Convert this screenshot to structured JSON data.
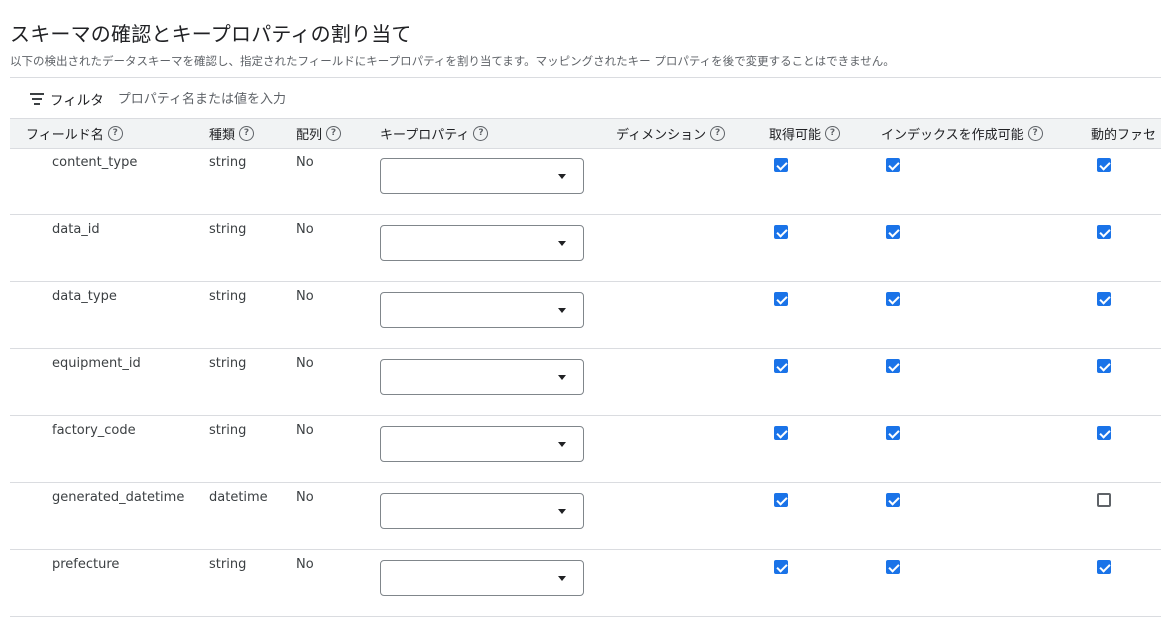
{
  "page": {
    "title": "スキーマの確認とキープロパティの割り当て",
    "description": "以下の検出されたデータスキーマを確認し、指定されたフィールドにキープロパティを割り当てます。マッピングされたキー プロパティを後で変更することはできません。"
  },
  "filter": {
    "label": "フィルタ",
    "placeholder": "プロパティ名または値を入力"
  },
  "columns": {
    "field_name": "フィールド名",
    "type": "種類",
    "array": "配列",
    "key_property": "キープロパティ",
    "dimension": "ディメンション",
    "retrievable": "取得可能",
    "indexable": "インデックスを作成可能",
    "dynamic_facet": "動的ファセ"
  },
  "help_icon_glyph": "?",
  "colors": {
    "accent": "#1a73e8",
    "header_bg": "#f1f3f4",
    "divider": "#dadce0"
  },
  "rows": [
    {
      "field": "content_type",
      "type": "string",
      "array": "No",
      "key_property": "",
      "retrievable": true,
      "indexable": true,
      "dynamic_facet": true
    },
    {
      "field": "data_id",
      "type": "string",
      "array": "No",
      "key_property": "",
      "retrievable": true,
      "indexable": true,
      "dynamic_facet": true
    },
    {
      "field": "data_type",
      "type": "string",
      "array": "No",
      "key_property": "",
      "retrievable": true,
      "indexable": true,
      "dynamic_facet": true
    },
    {
      "field": "equipment_id",
      "type": "string",
      "array": "No",
      "key_property": "",
      "retrievable": true,
      "indexable": true,
      "dynamic_facet": true
    },
    {
      "field": "factory_code",
      "type": "string",
      "array": "No",
      "key_property": "",
      "retrievable": true,
      "indexable": true,
      "dynamic_facet": true
    },
    {
      "field": "generated_datetime",
      "type": "datetime",
      "array": "No",
      "key_property": "",
      "retrievable": true,
      "indexable": true,
      "dynamic_facet": false
    },
    {
      "field": "prefecture",
      "type": "string",
      "array": "No",
      "key_property": "",
      "retrievable": true,
      "indexable": true,
      "dynamic_facet": true
    }
  ]
}
